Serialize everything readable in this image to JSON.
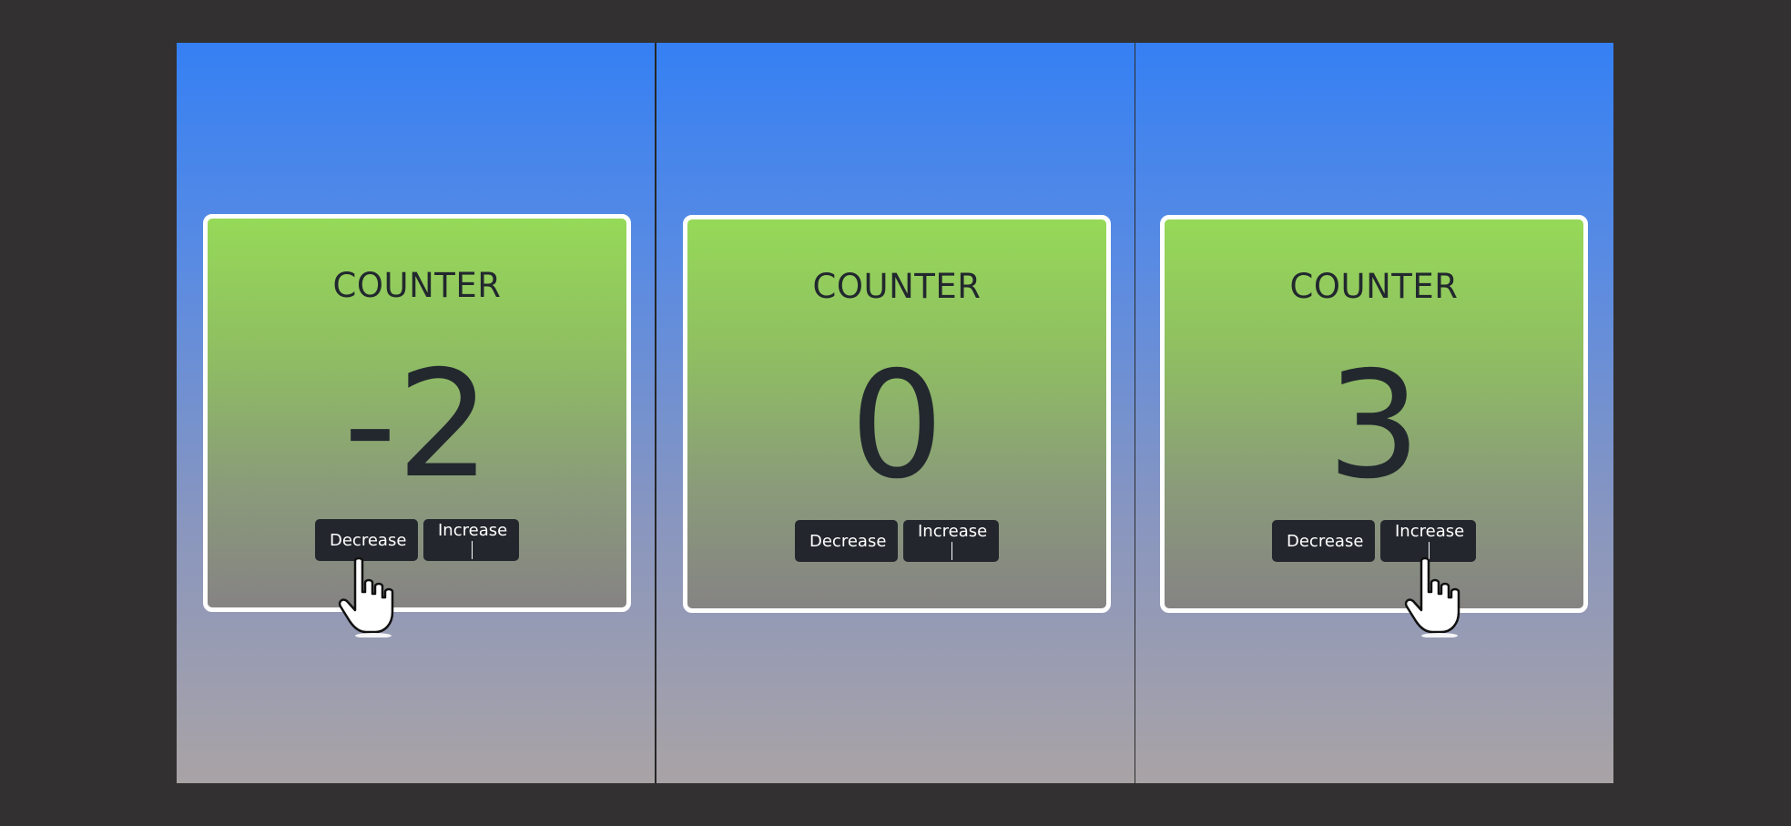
{
  "panels": [
    {
      "title": "COUNTER",
      "value": "-2",
      "decrease_label": "Decrease",
      "increase_label": "Increase",
      "pointer": "decrease"
    },
    {
      "title": "COUNTER",
      "value": "0",
      "decrease_label": "Decrease",
      "increase_label": "Increase",
      "pointer": "none"
    },
    {
      "title": "COUNTER",
      "value": "3",
      "decrease_label": "Decrease",
      "increase_label": "Increase",
      "pointer": "increase"
    }
  ],
  "icons": {
    "pointer": "hand-pointer-icon"
  },
  "colors": {
    "page_background": "#323030",
    "panel_gradient_top": "#3580f4",
    "panel_gradient_bottom": "#a9a3a5",
    "card_gradient_top": "#96d958",
    "card_gradient_bottom": "#858383",
    "card_border": "#ffffff",
    "button_background": "#23272d",
    "text_dark": "#22282e"
  }
}
